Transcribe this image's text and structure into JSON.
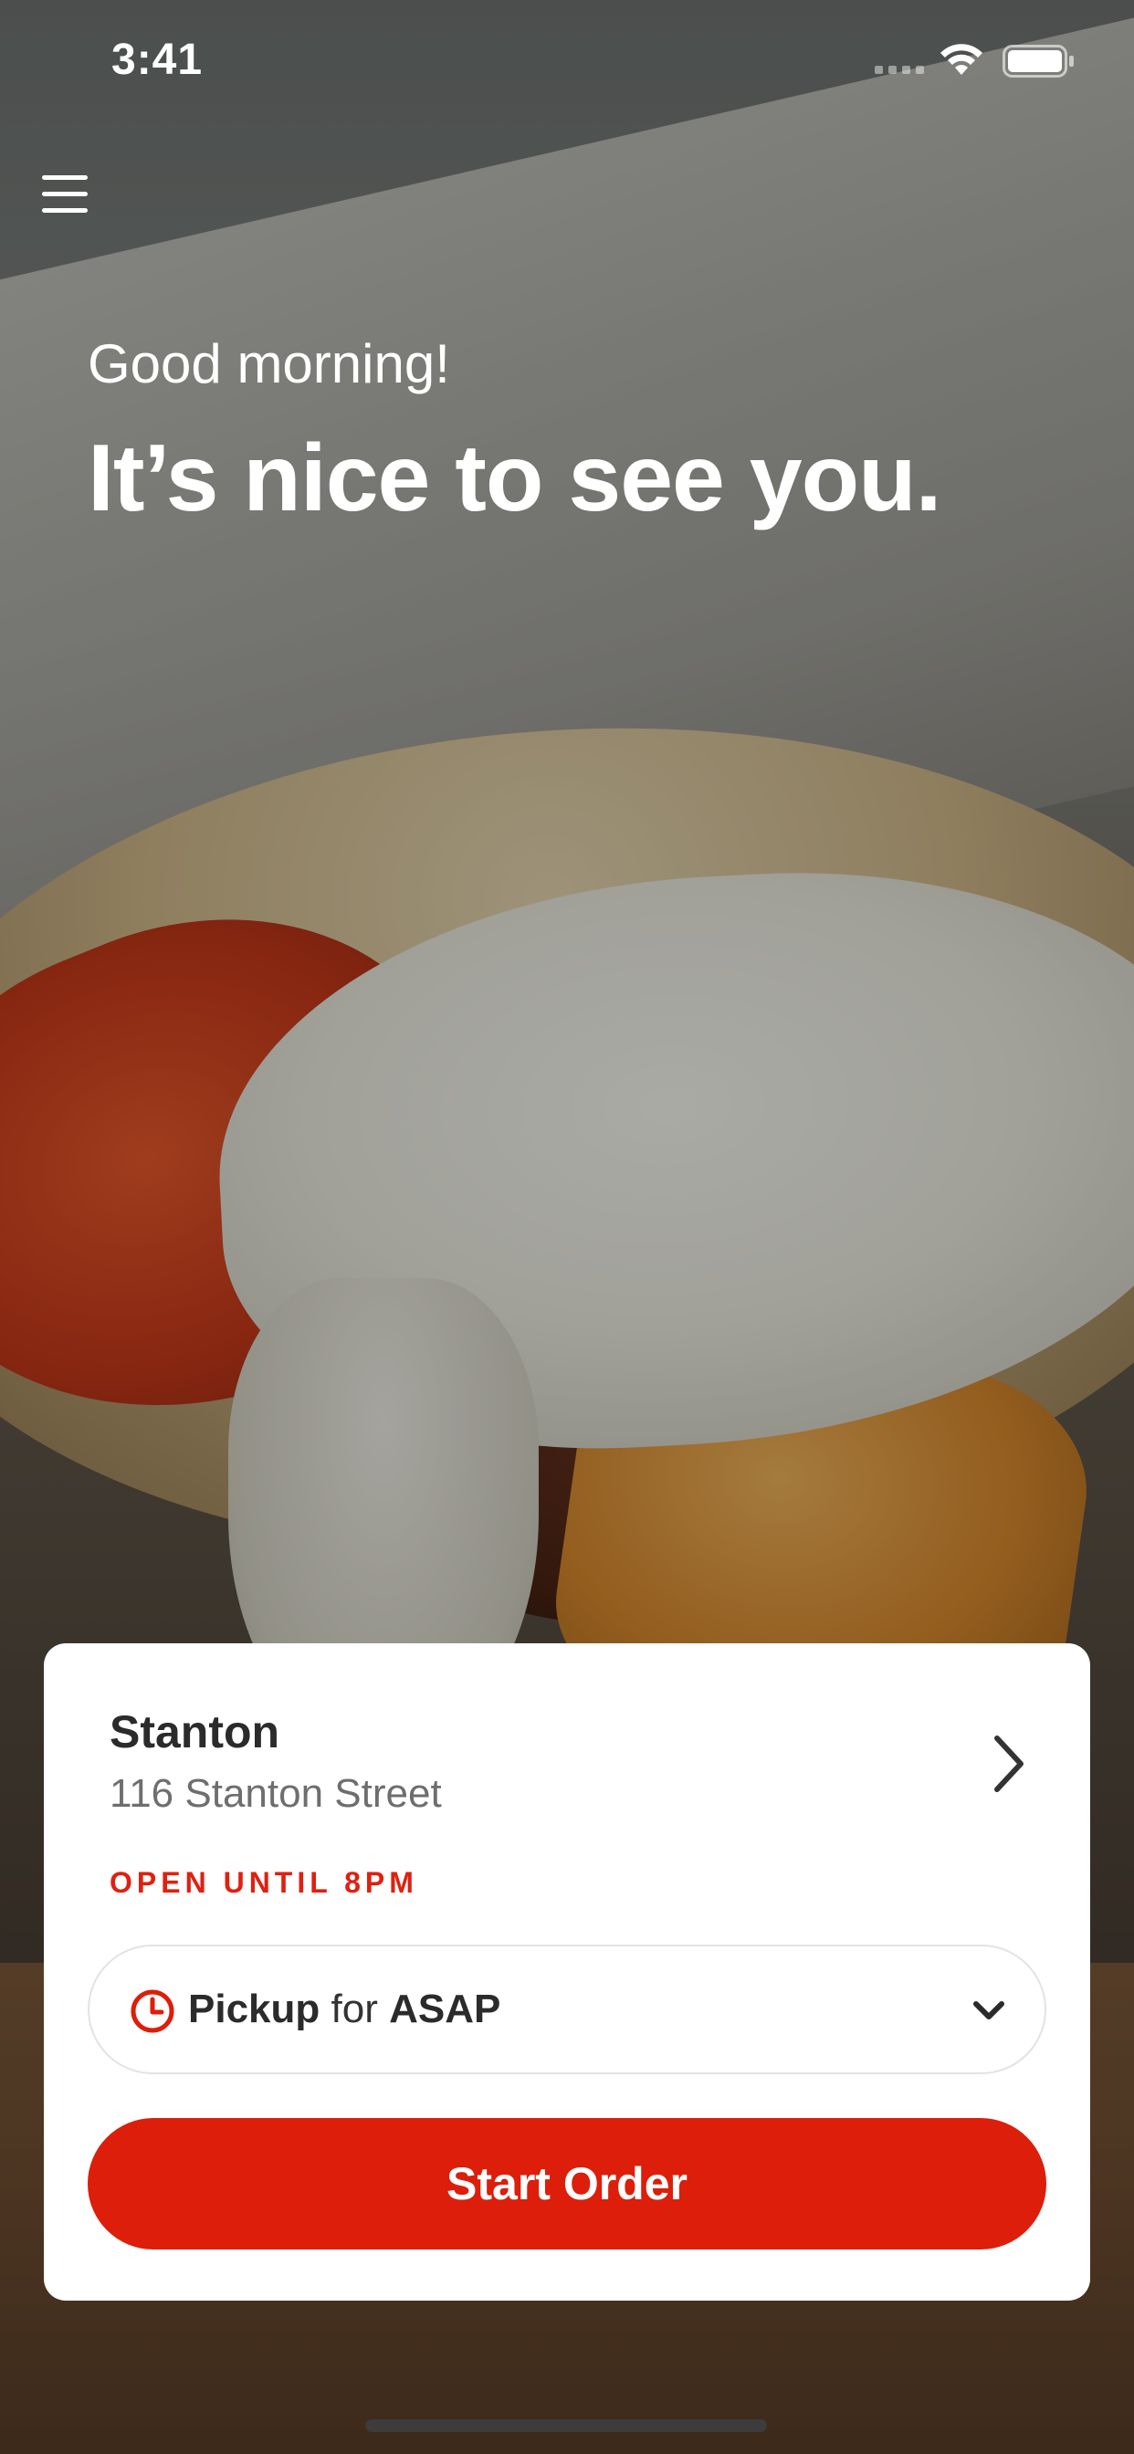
{
  "status_bar": {
    "time": "3:41"
  },
  "header": {
    "greeting": "Good morning!",
    "headline": "It’s nice to see you."
  },
  "store": {
    "name": "Stanton",
    "address": "116 Stanton Street",
    "status": "OPEN UNTIL 8PM"
  },
  "order": {
    "mode": "Pickup",
    "connector": "for",
    "time": "ASAP"
  },
  "cta": {
    "label": "Start Order"
  },
  "colors": {
    "accent": "#dc1e0a",
    "status_text": "#e02010",
    "card_background": "#ffffff"
  },
  "icons": [
    "menu-icon",
    "wifi-icon",
    "battery-icon",
    "chevron-right-icon",
    "clock-icon",
    "chevron-down-icon"
  ]
}
